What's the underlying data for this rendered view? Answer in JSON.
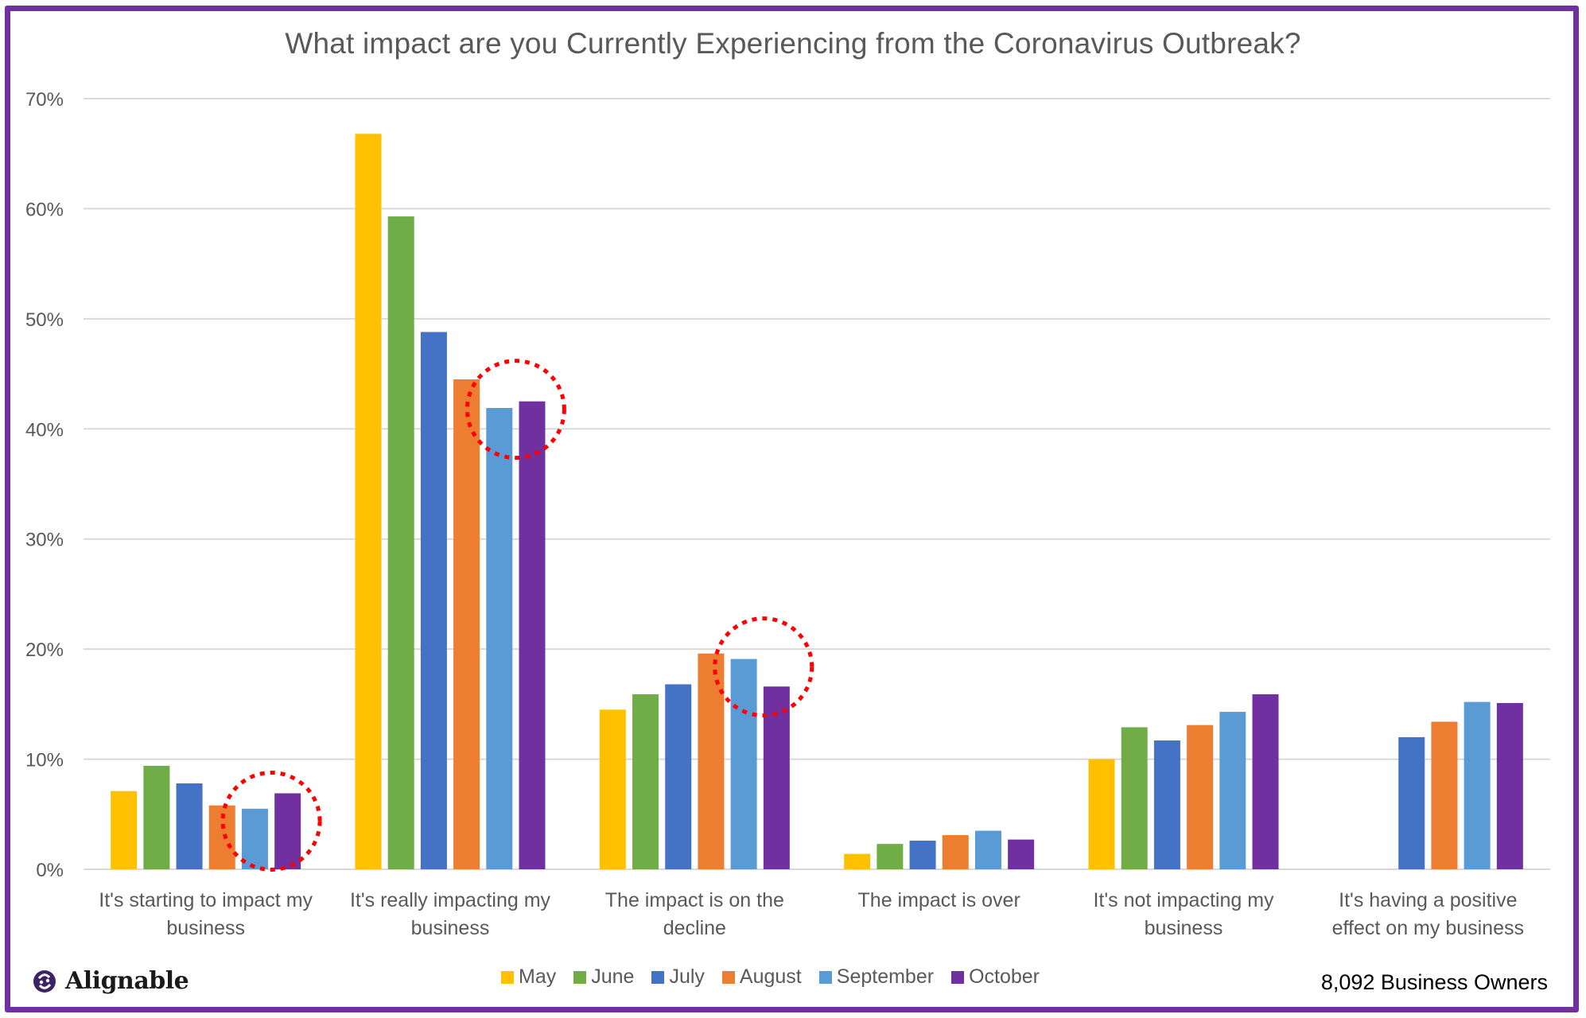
{
  "brand": {
    "name": "Alignable",
    "accent_color": "#7030a0"
  },
  "footer": {
    "sample_size": "8,092 Business Owners"
  },
  "highlights": {
    "description": "Red dotted circles highlight the September/October bars",
    "categories": [
      0,
      1,
      2
    ],
    "color": "#ff0000"
  },
  "chart_data": {
    "type": "bar",
    "title": "What impact are you Currently Experiencing from the Coronavirus Outbreak?",
    "xlabel": "",
    "ylabel": "",
    "ylim": [
      0,
      70
    ],
    "yticks": [
      0,
      10,
      20,
      30,
      40,
      50,
      60,
      70
    ],
    "ytick_labels": [
      "0%",
      "10%",
      "20%",
      "30%",
      "40%",
      "50%",
      "60%",
      "70%"
    ],
    "grid": true,
    "legend_position": "bottom",
    "categories": [
      [
        "It's starting to impact my",
        "business"
      ],
      [
        "It's really impacting my",
        "business"
      ],
      [
        "The impact is on the",
        "decline"
      ],
      [
        "The impact is over"
      ],
      [
        "It's not impacting my",
        "business"
      ],
      [
        "It's having a positive",
        "effect on my business"
      ]
    ],
    "series": [
      {
        "name": "May",
        "color": "#ffc000",
        "values": [
          7.1,
          66.8,
          14.5,
          1.4,
          10.0,
          null
        ]
      },
      {
        "name": "June",
        "color": "#70ad47",
        "values": [
          9.4,
          59.3,
          15.9,
          2.3,
          12.9,
          null
        ]
      },
      {
        "name": "July",
        "color": "#4472c4",
        "values": [
          7.8,
          48.8,
          16.8,
          2.6,
          11.7,
          12.0
        ]
      },
      {
        "name": "August",
        "color": "#ed7d31",
        "values": [
          5.8,
          44.5,
          19.6,
          3.1,
          13.1,
          13.4
        ]
      },
      {
        "name": "September",
        "color": "#5b9bd5",
        "values": [
          5.5,
          41.9,
          19.1,
          3.5,
          14.3,
          15.2
        ]
      },
      {
        "name": "October",
        "color": "#7030a0",
        "values": [
          6.9,
          42.5,
          16.6,
          2.7,
          15.9,
          15.1
        ]
      }
    ]
  }
}
